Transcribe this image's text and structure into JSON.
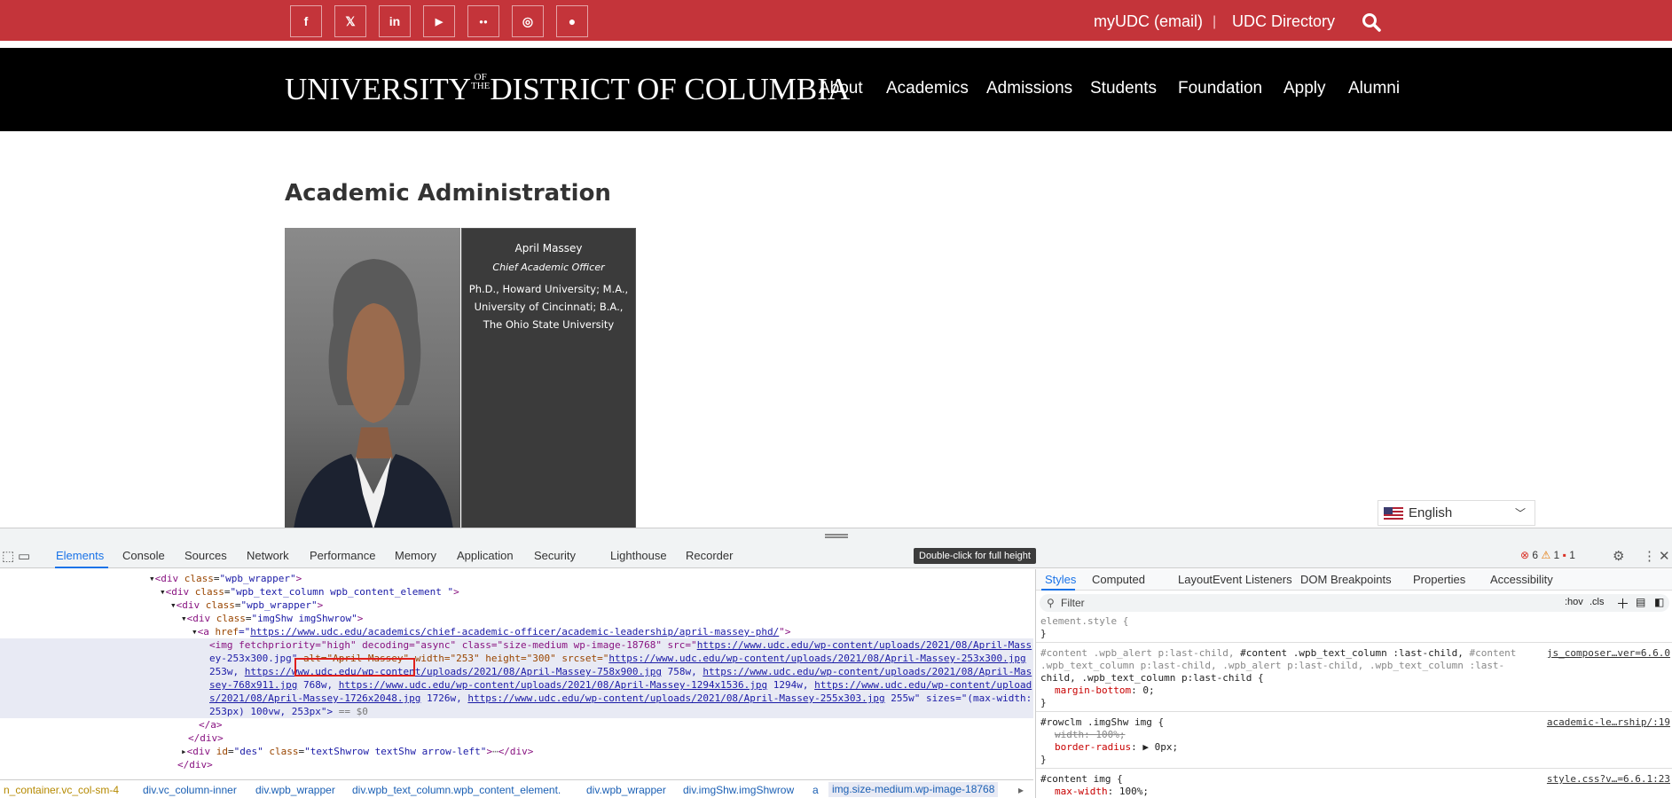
{
  "topbar": {
    "social_icons": [
      "facebook-icon",
      "twitter-icon",
      "linkedin-icon",
      "youtube-icon",
      "flickr-icon",
      "instagram-icon",
      "other-social-icon"
    ],
    "social_glyphs": [
      "f",
      "𝕏",
      "in",
      "▶",
      "●●",
      "◎",
      "●"
    ],
    "links": [
      "myUDC (email)",
      "UDC Directory"
    ],
    "separator": "|",
    "background": "#c4343a"
  },
  "nav": {
    "logo": {
      "pre": "UNIVERSITY",
      "of": "OF",
      "the": "THE",
      "post": "DISTRICT OF COLUMBIA"
    },
    "items": [
      "About",
      "Academics",
      "Admissions",
      "Students",
      "Foundation",
      "Apply",
      "Alumni"
    ]
  },
  "page": {
    "heading": "Academic Administration",
    "profile": {
      "name": "April Massey",
      "title": "Chief Academic Officer",
      "degrees": "Ph.D., Howard University; M.A., University of Cincinnati; B.A., The Ohio State University"
    },
    "language": "English"
  },
  "devtools": {
    "tabs": [
      "Elements",
      "Console",
      "Sources",
      "Network",
      "Performance",
      "Memory",
      "Application",
      "Security",
      "Lighthouse",
      "Recorder"
    ],
    "active_tab": "Elements",
    "tooltip": "Double-click for full height",
    "errors": "6",
    "warnings": "1",
    "issues": "1",
    "dom": {
      "l1": {
        "open": "<",
        "tag": "div",
        "attr": "class",
        "val": "\"wpb_wrapper\"",
        "close": ">"
      },
      "l2": {
        "open": "<",
        "tag": "div",
        "attr": "class",
        "val": "\"wpb_text_column wpb_content_element \"",
        "close": ">"
      },
      "l3": {
        "open": "<",
        "tag": "div",
        "attr": "class",
        "val": "\"wpb_wrapper\"",
        "close": ">"
      },
      "l4": {
        "open": "<",
        "tag": "div",
        "attr": "class",
        "val": "\"imgShw imgShwrow\"",
        "close": ">"
      },
      "l5": {
        "open": "<",
        "tag": "a",
        "attr": "href",
        "eq": "=\"",
        "url": "https://www.udc.edu/academics/chief-academic-officer/academic-leadership/april-massey-phd/",
        "close": "\">"
      },
      "l6a": "<img fetchpriority=\"high\" decoding=\"async\" class=\"size-medium wp-image-18768\" src=\"",
      "l6b": "https://www.udc.edu/wp-content/uploads/2021/08/April-Mass",
      "l7a": "ey-253x300.jpg\"",
      "l7b": "alt=\"April Massey\"",
      "l7c": "width=\"253\" height=\"300\" srcset=\"",
      "l7d": "https://www.udc.edu/wp-content/uploads/2021/08/April-Massey-253x300.jpg",
      "l8a": "253w,",
      "l8b": "https://www.udc.edu/wp-content/uploads/2021/08/April-Massey-758x900.jpg",
      "l8c": "758w,",
      "l8d": "https://www.udc.edu/wp-content/uploads/2021/08/April-Mas",
      "l9a": "sey-768x911.jpg",
      "l9b": "768w,",
      "l9c": "https://www.udc.edu/wp-content/uploads/2021/08/April-Massey-1294x1536.jpg",
      "l9d": "1294w,",
      "l9e": "https://www.udc.edu/wp-content/upload",
      "l10a": "s/2021/08/April-Massey-1726x2048.jpg",
      "l10b": "1726w,",
      "l10c": "https://www.udc.edu/wp-content/uploads/2021/08/April-Massey-255x303.jpg",
      "l10d": "255w\" sizes=\"(max-width:",
      "l11a": "253px) 100vw, 253px\">",
      "l11b": " == $0",
      "l12": "</a>",
      "l13": "</div>",
      "l14": {
        "open": "<",
        "tag": "div",
        "attr1": "id",
        "val1": "\"des\"",
        "attr2": "class",
        "val2": "\"textShwrow textShw arrow-left\"",
        "mid": ">",
        "ellipsis": "⋯",
        "close": "</div>"
      },
      "l15": "</div>"
    },
    "breadcrumbs": [
      "n_container.vc_col-sm-4",
      "div.vc_column-inner",
      "div.wpb_wrapper",
      "div.wpb_text_column.wpb_content_element.",
      "div.wpb_wrapper",
      "div.imgShw.imgShwrow",
      "a",
      "img.size-medium.wp-image-18768"
    ],
    "styles": {
      "tabs": [
        "Styles",
        "Computed",
        "Layout",
        "Event Listeners",
        "DOM Breakpoints",
        "Properties",
        "Accessibility"
      ],
      "filter_placeholder": "Filter",
      "hov": ":hov",
      "cls": ".cls",
      "rules": {
        "r0": "element.style {",
        "r0end": "}",
        "r1a_dim": "#content .wpb_alert p:last-child,",
        "r1a": " #content .wpb_text_column :last-child,",
        "r1a_dim2": " #content",
        "r1b": ".wpb_text_column p:last-child, .wpb_alert p:last-child, .wpb_text_column :last-",
        "r1c": "child, .wpb_text_column p:last-child {",
        "r1src": "js_composer…ver=6.6.0",
        "r1prop": "margin-bottom",
        "r1val": ": 0;",
        "r1end": "}",
        "r2": "#rowclm .imgShw img {",
        "r2src": "academic-le…rship/:19",
        "r2p1": "width",
        "r2v1": ": 100%;",
        "r2p2": "border-radius",
        "r2v2": ": ▶ 0px;",
        "r2end": "}",
        "r3": "#content img {",
        "r3src": "style.css?v…=6.6.1:23",
        "r3p1": "max-width",
        "r3v1": ": 100%;"
      }
    }
  }
}
